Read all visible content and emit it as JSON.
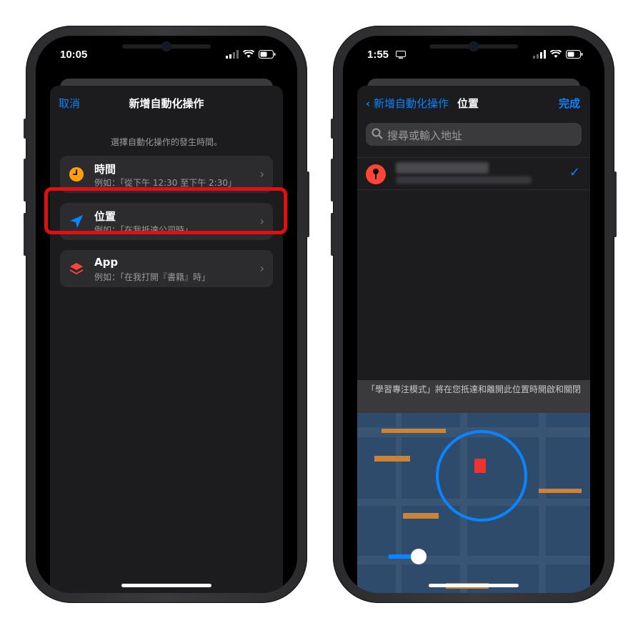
{
  "left_phone": {
    "status_time": "10:05",
    "nav": {
      "cancel": "取消",
      "title": "新增自動化操作"
    },
    "hint": "選擇自動化操作的發生時間。",
    "options": [
      {
        "label": "時間",
        "example": "例如：「從下午 12:30 至下午 2:30」",
        "icon": "clock-icon",
        "color": "#ff9f0a"
      },
      {
        "label": "位置",
        "example": "例如：「在我抵達公司時」",
        "icon": "location-arrow-icon",
        "color": "#0a84ff"
      },
      {
        "label": "App",
        "example": "例如：「在我打開『書籍』時」",
        "icon": "app-stack-icon",
        "color": "#ff453a"
      }
    ],
    "highlight_color": "#e10f0f"
  },
  "right_phone": {
    "status_time": "1:55",
    "nav": {
      "back": "新增自動化操作",
      "title": "位置",
      "done": "完成"
    },
    "search": {
      "placeholder": "搜尋或輸入地址"
    },
    "caption": "「學習專注模式」將在您抵達和離開此位置時開啟和關閉"
  },
  "colors": {
    "accent": "#0a84ff",
    "background": "#1c1c1e",
    "card": "#2c2c2e"
  }
}
